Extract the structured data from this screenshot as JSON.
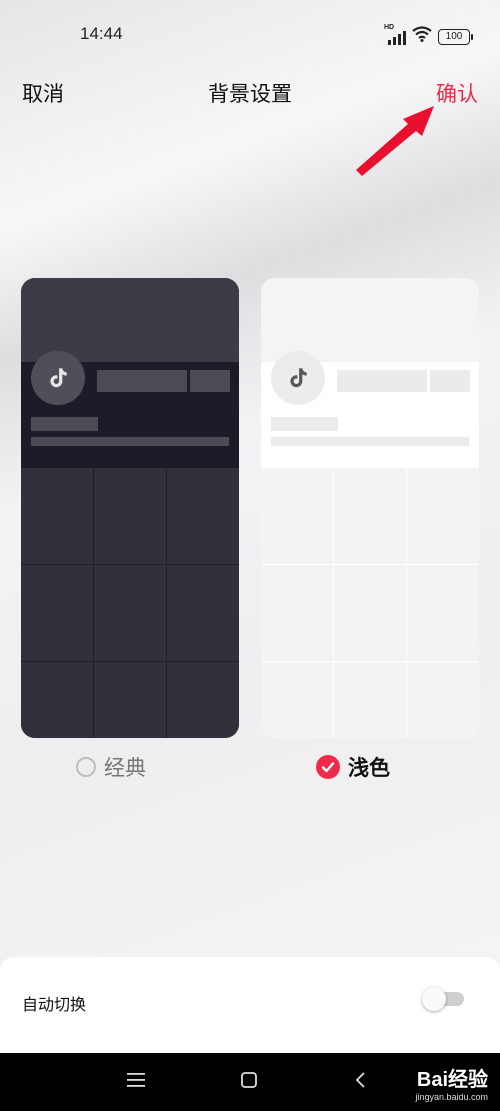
{
  "status_bar": {
    "time": "14:44",
    "battery": "100",
    "network": "HD"
  },
  "header": {
    "cancel_label": "取消",
    "title": "背景设置",
    "confirm_label": "确认"
  },
  "themes": {
    "classic": {
      "label": "经典",
      "selected": false
    },
    "light": {
      "label": "浅色",
      "selected": true
    }
  },
  "settings": {
    "auto_switch_label": "自动切换",
    "auto_switch_on": false
  },
  "watermark": {
    "brand": "Bai经验",
    "url": "jingyan.baidu.com"
  },
  "colors": {
    "accent": "#f02a4b",
    "classic_bg": "#2f303a",
    "light_bg": "#f3f3f3"
  }
}
